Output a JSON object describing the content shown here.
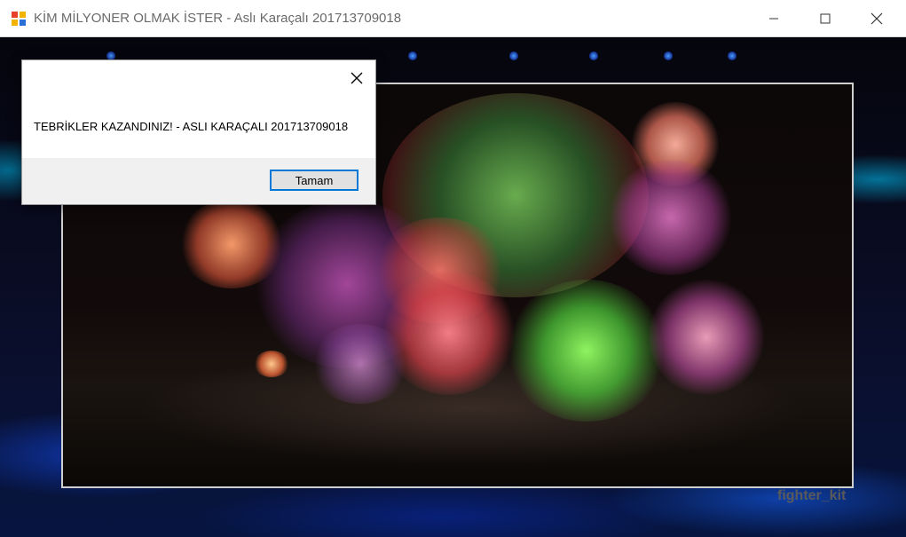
{
  "window": {
    "title": "KİM MİLYONER OLMAK İSTER - Aslı Karaçalı 201713709018",
    "icon": "app-icon",
    "controls": [
      "minimize-icon",
      "maximize-icon",
      "close-icon"
    ]
  },
  "stage": {
    "watermark": "fighter_kit"
  },
  "dialog": {
    "message": "TEBRİKLER KAZANDINIZ! - ASLI KARAÇALI 201713709018",
    "ok_label": "Tamam",
    "close_icon": "close-icon"
  },
  "colors": {
    "accent": "#0078d7",
    "title_text": "#6a6a6a",
    "dialog_footer": "#f0f0f0"
  }
}
